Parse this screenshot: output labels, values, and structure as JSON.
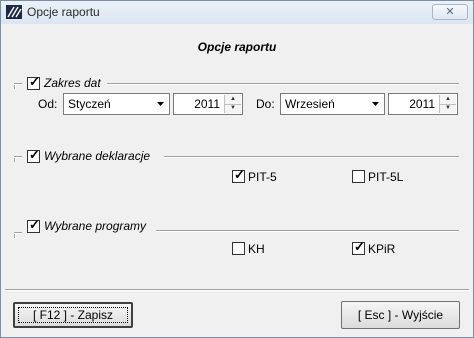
{
  "window": {
    "title": "Opcje raportu",
    "close_glyph": "✕"
  },
  "heading": "Opcje raportu",
  "date_range": {
    "label": "Zakres dat",
    "checked": true,
    "from_label": "Od:",
    "from_month": "Styczeń",
    "from_year": "2011",
    "to_label": "Do:",
    "to_month": "Wrzesień",
    "to_year": "2011"
  },
  "declarations": {
    "label": "Wybrane deklaracje",
    "checked": true,
    "items": [
      {
        "label": "PIT-5",
        "checked": true
      },
      {
        "label": "PIT-5L",
        "checked": false
      }
    ]
  },
  "programs": {
    "label": "Wybrane programy",
    "checked": true,
    "items": [
      {
        "label": "KH",
        "checked": false
      },
      {
        "label": "KPiR",
        "checked": true
      }
    ]
  },
  "buttons": {
    "save": "[ F12 ] - Zapisz",
    "exit": "[ Esc ] - Wyjście"
  },
  "check_glyph": "✓",
  "colors": {
    "title_bg": "#dbe6f2",
    "dialog_bg": "#f0f0f0"
  },
  "icons": {
    "app": "app-logo-icon",
    "combo_arrow": "chevron-down-icon",
    "spin": "spinner-arrows-icon"
  }
}
